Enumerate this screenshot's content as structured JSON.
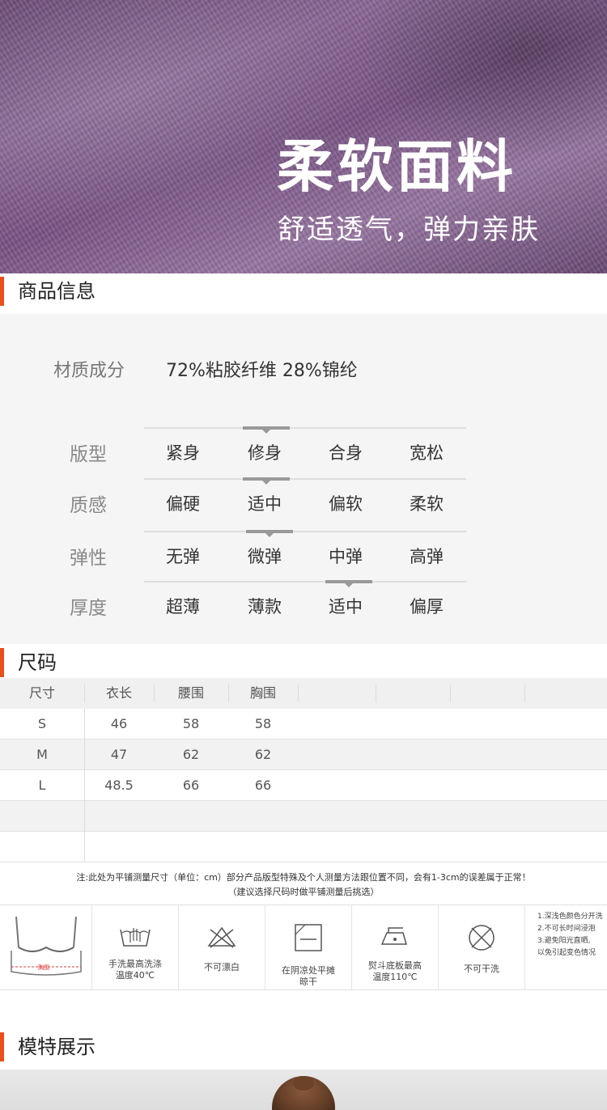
{
  "hero": {
    "title": "柔软面料",
    "subtitle": "舒适透气，弹力亲肤"
  },
  "sections": {
    "product_info": "商品信息",
    "size": "尺码",
    "model": "模特展示"
  },
  "material": {
    "label": "材质成分",
    "value": "72%粘胶纤维 28%锦纶"
  },
  "attributes": [
    {
      "label": "版型",
      "options": [
        "紧身",
        "修身",
        "合身",
        "宽松"
      ],
      "selected": 1
    },
    {
      "label": "质感",
      "options": [
        "偏硬",
        "适中",
        "偏软",
        "柔软"
      ],
      "selected": 1
    },
    {
      "label": "弹性",
      "options": [
        "无弹",
        "微弹",
        "中弹",
        "高弹"
      ],
      "selected": 1
    },
    {
      "label": "厚度",
      "options": [
        "超薄",
        "薄款",
        "适中",
        "偏厚"
      ],
      "selected": 2
    }
  ],
  "size_table": {
    "headers": [
      "尺寸",
      "衣长",
      "腰围",
      "胸围"
    ],
    "rows": [
      [
        "S",
        "46",
        "58",
        "58"
      ],
      [
        "M",
        "47",
        "62",
        "62"
      ],
      [
        "L",
        "48.5",
        "66",
        "66"
      ]
    ]
  },
  "notes": {
    "line1": "注:此处为平铺测量尺寸（单位：cm）部分产品版型特殊及个人测量方法跟位置不同，会有1-3cm的误差属于正常！",
    "line2": "（建议选择尺码时做平铺测量后挑选）"
  },
  "care": {
    "garment_tag": "胸围",
    "items": [
      {
        "icon": "hand-wash-icon",
        "text1": "手洗最高洗涤",
        "text2": "温度40℃"
      },
      {
        "icon": "no-bleach-icon",
        "text1": "不可漂白",
        "text2": ""
      },
      {
        "icon": "dry-flat-shade-icon",
        "text1": "在阴凉处平摊",
        "text2": "晾干"
      },
      {
        "icon": "iron-icon",
        "text1": "熨斗底板最高",
        "text2": "温度110℃"
      },
      {
        "icon": "no-dry-clean-icon",
        "text1": "不可干洗",
        "text2": ""
      }
    ],
    "tips": [
      "1.深浅色颜色分开洗",
      "2.不可长时间浸泡",
      "3.避免阳光直晒,",
      "以免引起变色情况"
    ]
  }
}
